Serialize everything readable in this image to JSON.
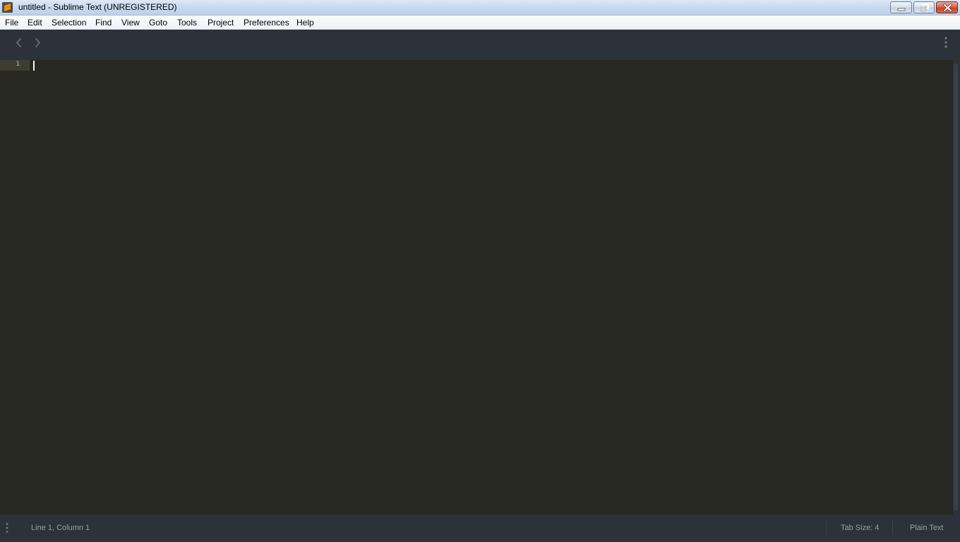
{
  "window": {
    "title": "untitled - Sublime Text (UNREGISTERED)",
    "icon": "sublime-text-icon",
    "controls": [
      "minimize-icon",
      "restore-icon",
      "close-icon"
    ]
  },
  "menu": {
    "items": [
      "File",
      "Edit",
      "Selection",
      "Find",
      "View",
      "Goto",
      "Tools",
      "Project",
      "Preferences",
      "Help"
    ]
  },
  "toolbar": {
    "back_icon": "chevron-left-icon",
    "forward_icon": "chevron-right-icon",
    "tab_menu_icon": "vertical-ellipsis-icon"
  },
  "editor": {
    "line_numbers": [
      "1"
    ],
    "content": ""
  },
  "status": {
    "menu_icon": "vertical-ellipsis-icon",
    "position": "Line 1, Column 1",
    "tab_size": "Tab Size: 4",
    "syntax": "Plain Text"
  },
  "colors": {
    "editor_background": "#272822",
    "chrome_background": "#2d3139",
    "line_highlight": "#3e3d32",
    "status_text": "#9aa0a8",
    "caret": "#f8f8f0"
  }
}
